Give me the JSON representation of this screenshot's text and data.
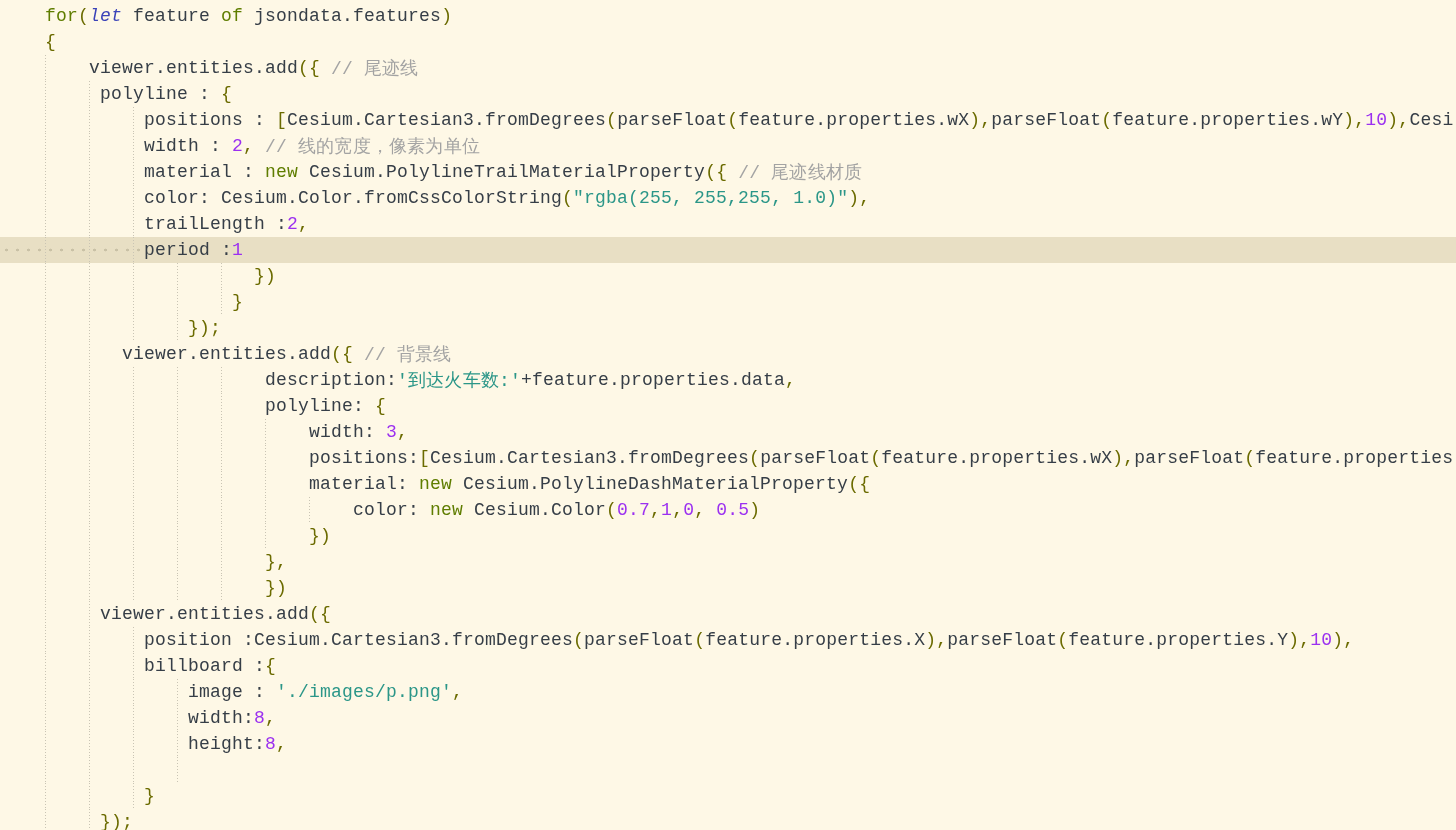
{
  "editor": {
    "lines": [
      {
        "kind": "code",
        "current": false,
        "tokens": [
          {
            "kind": "keyword",
            "text": "    for"
          },
          {
            "kind": "punct",
            "text": "("
          },
          {
            "kind": "decl",
            "text": "let"
          },
          {
            "kind": "plain",
            "text": " feature "
          },
          {
            "kind": "keyword",
            "text": "of"
          },
          {
            "kind": "plain",
            "text": " jsondata.features"
          },
          {
            "kind": "punct",
            "text": ")"
          }
        ]
      },
      {
        "kind": "code",
        "current": false,
        "tokens": [
          {
            "kind": "punct",
            "text": "    {"
          }
        ]
      },
      {
        "kind": "code",
        "current": false,
        "tokens": [
          {
            "kind": "plain",
            "text": "        viewer.entities.add"
          },
          {
            "kind": "punct",
            "text": "({"
          },
          {
            "kind": "comment",
            "text": " // 尾迹线"
          }
        ]
      },
      {
        "kind": "code",
        "current": false,
        "tokens": [
          {
            "kind": "plain",
            "text": "         polyline : "
          },
          {
            "kind": "punct",
            "text": "{"
          }
        ]
      },
      {
        "kind": "code",
        "current": false,
        "tokens": [
          {
            "kind": "plain",
            "text": "             positions : "
          },
          {
            "kind": "punct",
            "text": "["
          },
          {
            "kind": "plain",
            "text": "Cesium.Cartesian3.fromDegrees"
          },
          {
            "kind": "punct",
            "text": "("
          },
          {
            "kind": "plain",
            "text": "parseFloat"
          },
          {
            "kind": "punct",
            "text": "("
          },
          {
            "kind": "plain",
            "text": "feature.properties.wX"
          },
          {
            "kind": "punct",
            "text": "),"
          },
          {
            "kind": "plain",
            "text": "parseFloat"
          },
          {
            "kind": "punct",
            "text": "("
          },
          {
            "kind": "plain",
            "text": "feature.properties.wY"
          },
          {
            "kind": "punct",
            "text": "),"
          },
          {
            "kind": "number",
            "text": "10"
          },
          {
            "kind": "punct",
            "text": "),"
          },
          {
            "kind": "plain",
            "text": "Cesi"
          }
        ]
      },
      {
        "kind": "code",
        "current": false,
        "tokens": [
          {
            "kind": "plain",
            "text": "             width : "
          },
          {
            "kind": "number",
            "text": "2"
          },
          {
            "kind": "punct",
            "text": ","
          },
          {
            "kind": "comment",
            "text": " // 线的宽度，像素为单位"
          }
        ]
      },
      {
        "kind": "code",
        "current": false,
        "tokens": [
          {
            "kind": "plain",
            "text": "             material : "
          },
          {
            "kind": "keyword",
            "text": "new"
          },
          {
            "kind": "plain",
            "text": " Cesium.PolylineTrailMaterialProperty"
          },
          {
            "kind": "punct",
            "text": "({"
          },
          {
            "kind": "comment",
            "text": " // 尾迹线材质"
          }
        ]
      },
      {
        "kind": "code",
        "current": false,
        "tokens": [
          {
            "kind": "plain",
            "text": "             color: Cesium.Color.fromCssColorString"
          },
          {
            "kind": "punct",
            "text": "("
          },
          {
            "kind": "string",
            "text": "\"rgba(255, 255,255, 1.0)\""
          },
          {
            "kind": "punct",
            "text": "),"
          }
        ]
      },
      {
        "kind": "code",
        "current": false,
        "tokens": [
          {
            "kind": "plain",
            "text": "             trailLength :"
          },
          {
            "kind": "number",
            "text": "2"
          },
          {
            "kind": "punct",
            "text": ","
          }
        ]
      },
      {
        "kind": "code",
        "current": true,
        "tokens": [
          {
            "kind": "plain",
            "text": "             period :"
          },
          {
            "kind": "number",
            "text": "1"
          }
        ]
      },
      {
        "kind": "code",
        "current": false,
        "tokens": [
          {
            "kind": "punct",
            "text": "                       })"
          }
        ]
      },
      {
        "kind": "code",
        "current": false,
        "tokens": [
          {
            "kind": "punct",
            "text": "                     }"
          }
        ]
      },
      {
        "kind": "code",
        "current": false,
        "tokens": [
          {
            "kind": "punct",
            "text": "                 });"
          }
        ]
      },
      {
        "kind": "code",
        "current": false,
        "tokens": [
          {
            "kind": "plain",
            "text": "           viewer.entities.add"
          },
          {
            "kind": "punct",
            "text": "({"
          },
          {
            "kind": "comment",
            "text": " // 背景线"
          }
        ]
      },
      {
        "kind": "code",
        "current": false,
        "tokens": [
          {
            "kind": "plain",
            "text": "                        description:"
          },
          {
            "kind": "string",
            "text": "'到达火车数:'"
          },
          {
            "kind": "plain",
            "text": "+feature.properties.data"
          },
          {
            "kind": "punct",
            "text": ","
          }
        ]
      },
      {
        "kind": "code",
        "current": false,
        "tokens": [
          {
            "kind": "plain",
            "text": "                        polyline: "
          },
          {
            "kind": "punct",
            "text": "{"
          }
        ]
      },
      {
        "kind": "code",
        "current": false,
        "tokens": [
          {
            "kind": "plain",
            "text": "                            width: "
          },
          {
            "kind": "number",
            "text": "3"
          },
          {
            "kind": "punct",
            "text": ","
          }
        ]
      },
      {
        "kind": "code",
        "current": false,
        "tokens": [
          {
            "kind": "plain",
            "text": "                            positions:"
          },
          {
            "kind": "punct",
            "text": "["
          },
          {
            "kind": "plain",
            "text": "Cesium.Cartesian3.fromDegrees"
          },
          {
            "kind": "punct",
            "text": "("
          },
          {
            "kind": "plain",
            "text": "parseFloat"
          },
          {
            "kind": "punct",
            "text": "("
          },
          {
            "kind": "plain",
            "text": "feature.properties.wX"
          },
          {
            "kind": "punct",
            "text": "),"
          },
          {
            "kind": "plain",
            "text": "parseFloat"
          },
          {
            "kind": "punct",
            "text": "("
          },
          {
            "kind": "plain",
            "text": "feature.properties"
          }
        ]
      },
      {
        "kind": "code",
        "current": false,
        "tokens": [
          {
            "kind": "plain",
            "text": "                            material: "
          },
          {
            "kind": "keyword",
            "text": "new"
          },
          {
            "kind": "plain",
            "text": " Cesium.PolylineDashMaterialProperty"
          },
          {
            "kind": "punct",
            "text": "({"
          }
        ]
      },
      {
        "kind": "code",
        "current": false,
        "tokens": [
          {
            "kind": "plain",
            "text": "                                color: "
          },
          {
            "kind": "keyword",
            "text": "new"
          },
          {
            "kind": "plain",
            "text": " Cesium.Color"
          },
          {
            "kind": "punct",
            "text": "("
          },
          {
            "kind": "number",
            "text": "0.7"
          },
          {
            "kind": "punct",
            "text": ","
          },
          {
            "kind": "number",
            "text": "1"
          },
          {
            "kind": "punct",
            "text": ","
          },
          {
            "kind": "number",
            "text": "0"
          },
          {
            "kind": "punct",
            "text": ", "
          },
          {
            "kind": "number",
            "text": "0.5"
          },
          {
            "kind": "punct",
            "text": ")"
          }
        ]
      },
      {
        "kind": "code",
        "current": false,
        "tokens": [
          {
            "kind": "punct",
            "text": "                            })"
          }
        ]
      },
      {
        "kind": "code",
        "current": false,
        "tokens": [
          {
            "kind": "punct",
            "text": "                        },"
          }
        ]
      },
      {
        "kind": "code",
        "current": false,
        "tokens": [
          {
            "kind": "punct",
            "text": "                        })"
          }
        ]
      },
      {
        "kind": "code",
        "current": false,
        "tokens": [
          {
            "kind": "plain",
            "text": "         viewer.entities.add"
          },
          {
            "kind": "punct",
            "text": "({"
          }
        ]
      },
      {
        "kind": "code",
        "current": false,
        "tokens": [
          {
            "kind": "plain",
            "text": "             position :Cesium.Cartesian3.fromDegrees"
          },
          {
            "kind": "punct",
            "text": "("
          },
          {
            "kind": "plain",
            "text": "parseFloat"
          },
          {
            "kind": "punct",
            "text": "("
          },
          {
            "kind": "plain",
            "text": "feature.properties.X"
          },
          {
            "kind": "punct",
            "text": "),"
          },
          {
            "kind": "plain",
            "text": "parseFloat"
          },
          {
            "kind": "punct",
            "text": "("
          },
          {
            "kind": "plain",
            "text": "feature.properties.Y"
          },
          {
            "kind": "punct",
            "text": "),"
          },
          {
            "kind": "number",
            "text": "10"
          },
          {
            "kind": "punct",
            "text": "),"
          }
        ]
      },
      {
        "kind": "code",
        "current": false,
        "tokens": [
          {
            "kind": "plain",
            "text": "             billboard :"
          },
          {
            "kind": "punct",
            "text": "{"
          }
        ]
      },
      {
        "kind": "code",
        "current": false,
        "tokens": [
          {
            "kind": "plain",
            "text": "                 image : "
          },
          {
            "kind": "string",
            "text": "'./images/p.png'"
          },
          {
            "kind": "punct",
            "text": ","
          }
        ]
      },
      {
        "kind": "code",
        "current": false,
        "tokens": [
          {
            "kind": "plain",
            "text": "                 width:"
          },
          {
            "kind": "number",
            "text": "8"
          },
          {
            "kind": "punct",
            "text": ","
          }
        ]
      },
      {
        "kind": "code",
        "current": false,
        "tokens": [
          {
            "kind": "plain",
            "text": "                 height:"
          },
          {
            "kind": "number",
            "text": "8"
          },
          {
            "kind": "punct",
            "text": ","
          }
        ]
      },
      {
        "kind": "blank",
        "current": false
      },
      {
        "kind": "code",
        "current": false,
        "tokens": [
          {
            "kind": "punct",
            "text": "             }"
          }
        ]
      },
      {
        "kind": "code",
        "current": false,
        "tokens": [
          {
            "kind": "punct",
            "text": "         });"
          }
        ]
      }
    ]
  }
}
